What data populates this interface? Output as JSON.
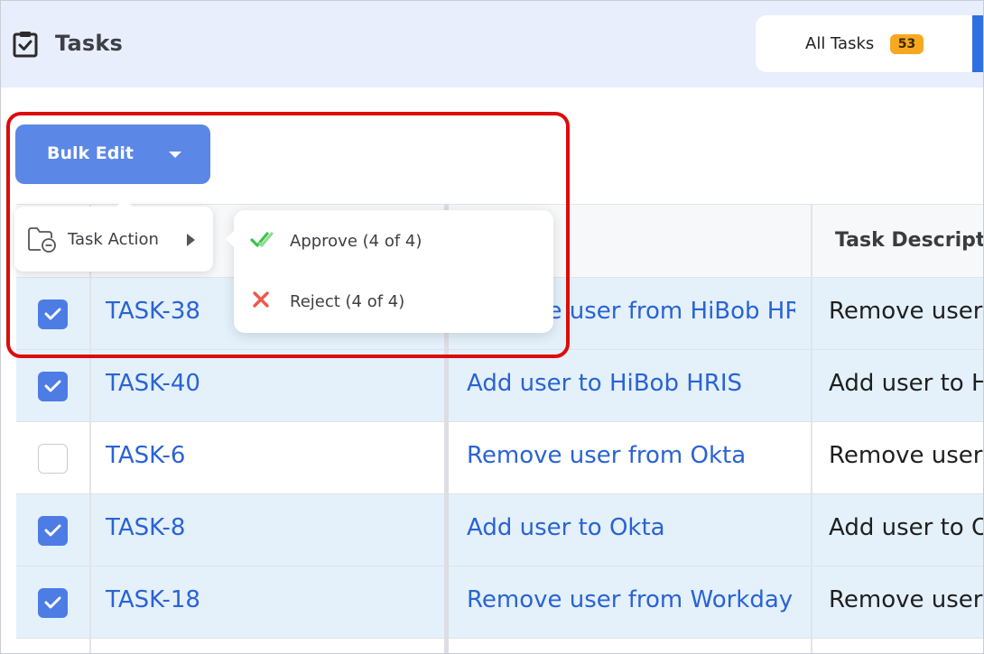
{
  "header": {
    "title": "Tasks",
    "icon": "clipboard-check-icon",
    "tab_all_label": "All Tasks",
    "tab_all_count": "53"
  },
  "bulk_edit": {
    "label": "Bulk Edit"
  },
  "menu": {
    "task_action_label": "Task Action",
    "approve_label": "Approve (4 of 4)",
    "reject_label": "Reject (4 of 4)"
  },
  "table": {
    "columns": [
      "",
      "",
      "Task Description"
    ],
    "rows": [
      {
        "id": "TASK-38",
        "name": "Remove user from HiBob HRIS",
        "desc": "Remove user from HiBob HRIS",
        "selected": true
      },
      {
        "id": "TASK-40",
        "name": "Add user to HiBob HRIS",
        "desc": "Add user to HiBob HRIS",
        "selected": true
      },
      {
        "id": "TASK-6",
        "name": "Remove user from Okta",
        "desc": "Remove user from Okta",
        "selected": false
      },
      {
        "id": "TASK-8",
        "name": "Add user to Okta",
        "desc": "Add user to Okta",
        "selected": true
      },
      {
        "id": "TASK-18",
        "name": "Remove user from Workday",
        "desc": "Remove user from Workday",
        "selected": true
      }
    ]
  },
  "colors": {
    "accent": "#5b87e6",
    "link": "#2a63d4",
    "badge": "#f8a820",
    "highlight": "#dd0b0b",
    "row_selected": "#e4f1fb"
  }
}
